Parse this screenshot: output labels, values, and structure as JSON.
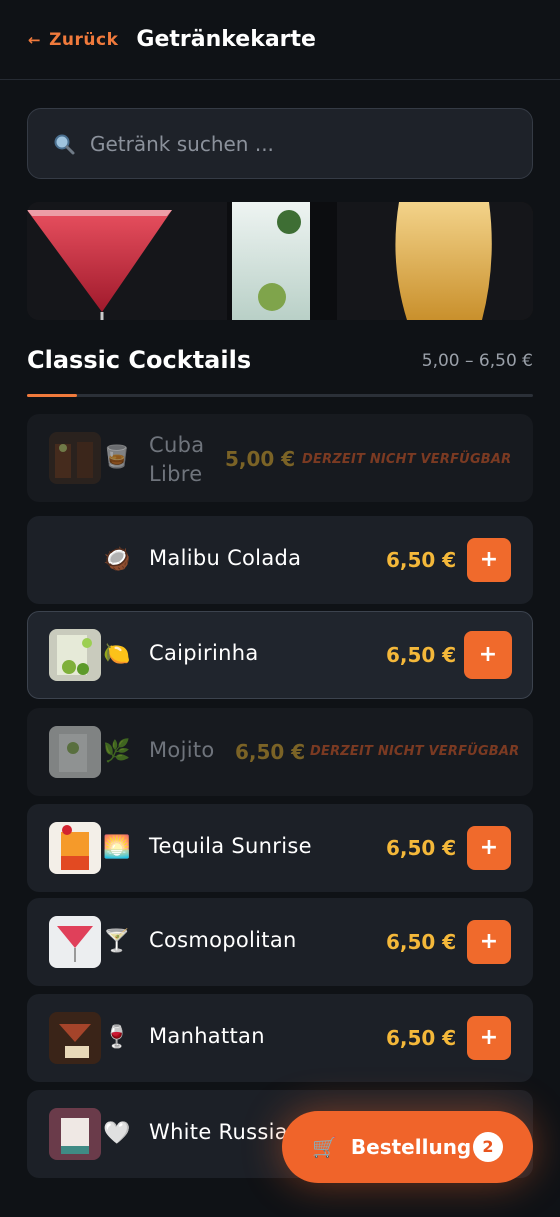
{
  "header": {
    "back_arrow": "←",
    "back_label": "Zurück",
    "title": "Getränkekarte"
  },
  "search": {
    "placeholder": "Getränk suchen ...",
    "icon": "search-icon"
  },
  "section": {
    "title": "Classic Cocktails",
    "price_range": "5,00 – 6,50 €"
  },
  "items": [
    {
      "name_line1": "Cuba",
      "name_line2": "Libre",
      "emoji": "🥃",
      "price": "5,00 €",
      "status": "DERZEIT NICHT VERFÜGBAR",
      "available": false
    },
    {
      "name": "Malibu Colada",
      "emoji": "🥥",
      "price": "6,50 €",
      "add": "+",
      "available": true
    },
    {
      "name": "Caipirinha",
      "emoji": "🍋",
      "price": "6,50 €",
      "add": "+",
      "available": true,
      "selected": true
    },
    {
      "name": "Mojito",
      "emoji": "🌿",
      "price": "6,50 €",
      "status": "DERZEIT NICHT VERFÜGBAR",
      "available": false
    },
    {
      "name": "Tequila Sunrise",
      "emoji": "🌅",
      "price": "6,50 €",
      "add": "+",
      "available": true
    },
    {
      "name": "Cosmopolitan",
      "emoji": "🍸",
      "price": "6,50 €",
      "add": "+",
      "available": true
    },
    {
      "name": "Manhattan",
      "emoji": "🍷",
      "price": "6,50 €",
      "add": "+",
      "available": true
    },
    {
      "name": "White Russia",
      "emoji": "🤍",
      "available": true
    }
  ],
  "cart": {
    "icon": "🛒",
    "label": "Bestellung",
    "count": "2"
  },
  "colors": {
    "accent": "#f06a2c",
    "price": "#f4b83a",
    "background": "#0f1216",
    "card": "#1c2027"
  }
}
